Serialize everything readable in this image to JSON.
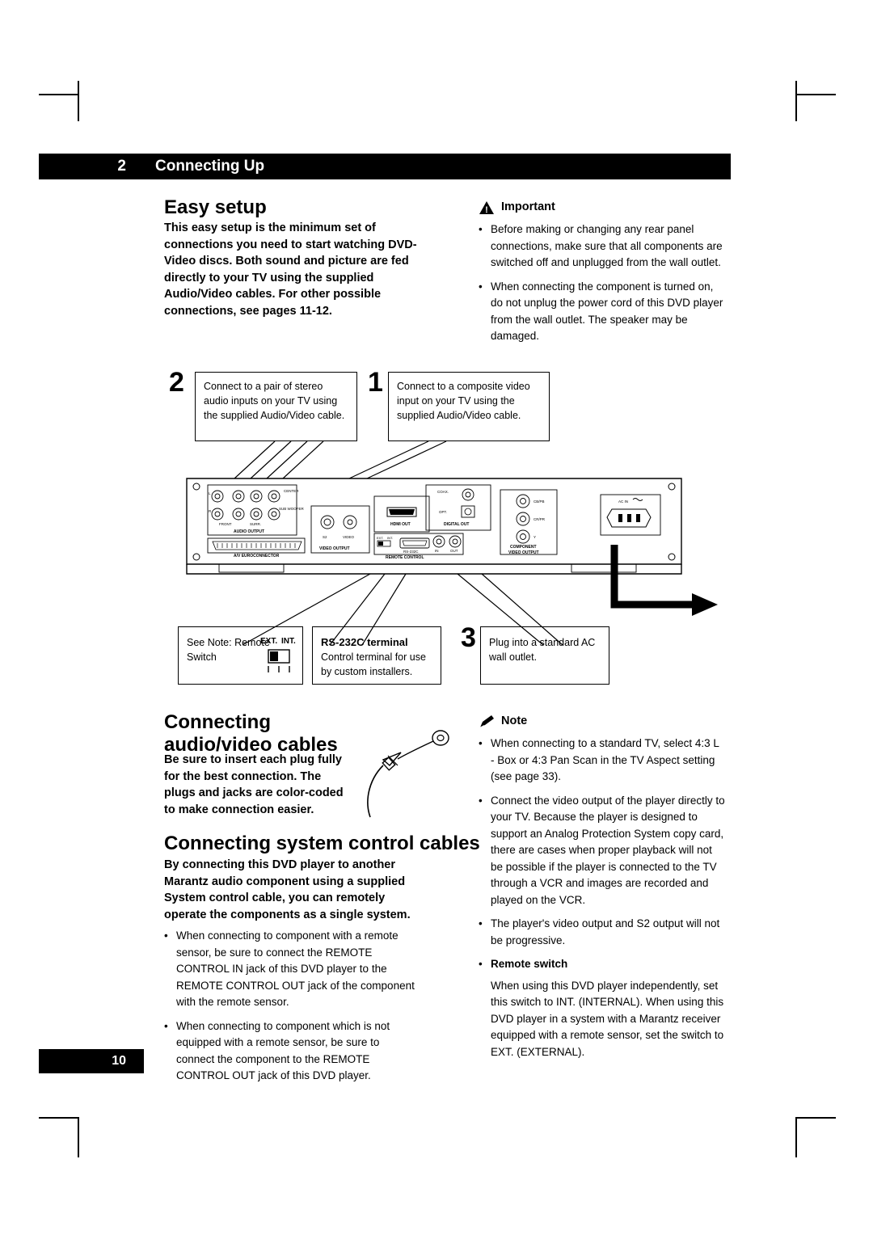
{
  "header": {
    "chapter_number": "2",
    "title": "Connecting Up"
  },
  "footer": {
    "page_number": "10"
  },
  "sections": {
    "easy_setup": {
      "title": "Easy setup",
      "intro": "This easy setup is the minimum set of connections you need to start watching DVD-Video discs. Both sound and picture are fed directly to your TV using the supplied Audio/Video cables. For other possible connections, see pages 11-12."
    },
    "audio_video_cables": {
      "title": "Connecting audio/video cables",
      "body": "Be sure to insert each plug fully for the best connection. The plugs and jacks are color-coded to make connection easier."
    },
    "system_control": {
      "title": "Connecting system control cables",
      "intro": "By connecting this DVD player to another Marantz audio component using a supplied System control cable, you can remotely operate the components as a single system.",
      "bullets": [
        "When connecting to component with a remote sensor, be sure to connect the REMOTE CONTROL IN jack of this DVD player to the REMOTE CONTROL OUT jack of the component with the remote sensor.",
        "When connecting to component which is not equipped with a remote sensor, be sure to connect the component to the REMOTE CONTROL OUT jack of this DVD player."
      ]
    }
  },
  "important_box": {
    "icon": "warning-icon",
    "title": "Important",
    "bullets": [
      "Before making or changing any rear panel connections, make sure that all components are switched off and unplugged from the wall outlet.",
      "When connecting the component is turned on, do not unplug the power cord of this DVD player from the wall outlet. The speaker may be damaged."
    ]
  },
  "note_box": {
    "icon": "pencil-note-icon",
    "title": "Note",
    "bullets": [
      "When connecting to a standard TV, select 4:3 L - Box or 4:3 Pan Scan in the TV Aspect setting (see page 33).",
      "Connect the video output of the player directly to your TV. Because the player is designed to support an Analog Protection System copy card, there are cases when proper playback will not be possible if the player is connected to the TV through a VCR and images are recorded and played on the VCR.",
      "The player's video output and S2 output will not be progressive."
    ],
    "sub_title": "Remote switch",
    "sub_body": "When using this DVD player independently, set this switch to INT. (INTERNAL). When using this DVD player in a system with a Marantz receiver equipped with a remote sensor, set the switch to EXT. (EXTERNAL)."
  },
  "callouts": [
    {
      "number": "2",
      "text": "Connect to a pair of stereo audio inputs on your TV using the supplied Audio/Video cable."
    },
    {
      "number": "1",
      "text": "Connect to a composite video input on your TV using the supplied Audio/Video cable."
    },
    {
      "number": "",
      "text": "See Note: Remote Switch",
      "switch_labels": "EXT.  INT."
    },
    {
      "number": "",
      "title": "RS-232C terminal",
      "text": "Control terminal for use by custom installers."
    },
    {
      "number": "3",
      "text": "Plug into a standard AC wall outlet."
    }
  ],
  "rear_panel_labels": {
    "center": "CENTER",
    "subwoofer": "SUB WOOFER",
    "front": "FRONT",
    "surr": "SURR.",
    "audio_output": "AUDIO OUTPUT",
    "av_euroconnector": "A/V EUROCONNECTOR",
    "hdmi_out": "HDMI OUT",
    "coax": "COAX.",
    "opt": "OPT.",
    "digital_out": "DIGITAL OUT",
    "video_output_1": "VIDEO OUTPUT",
    "s2": "S2",
    "video": "VIDEO",
    "ext": "EXT.",
    "int": "INT.",
    "rs232c": "RS-232C",
    "remote_control": "REMOTE CONTROL",
    "in": "IN",
    "out": "OUT",
    "component": "COMPONENT",
    "video_output_2": "VIDEO OUTPUT",
    "cb": "CB/PB",
    "cr": "CR/PR",
    "y": "Y",
    "ac_in": "AC IN",
    "l": "L",
    "r": "R"
  }
}
